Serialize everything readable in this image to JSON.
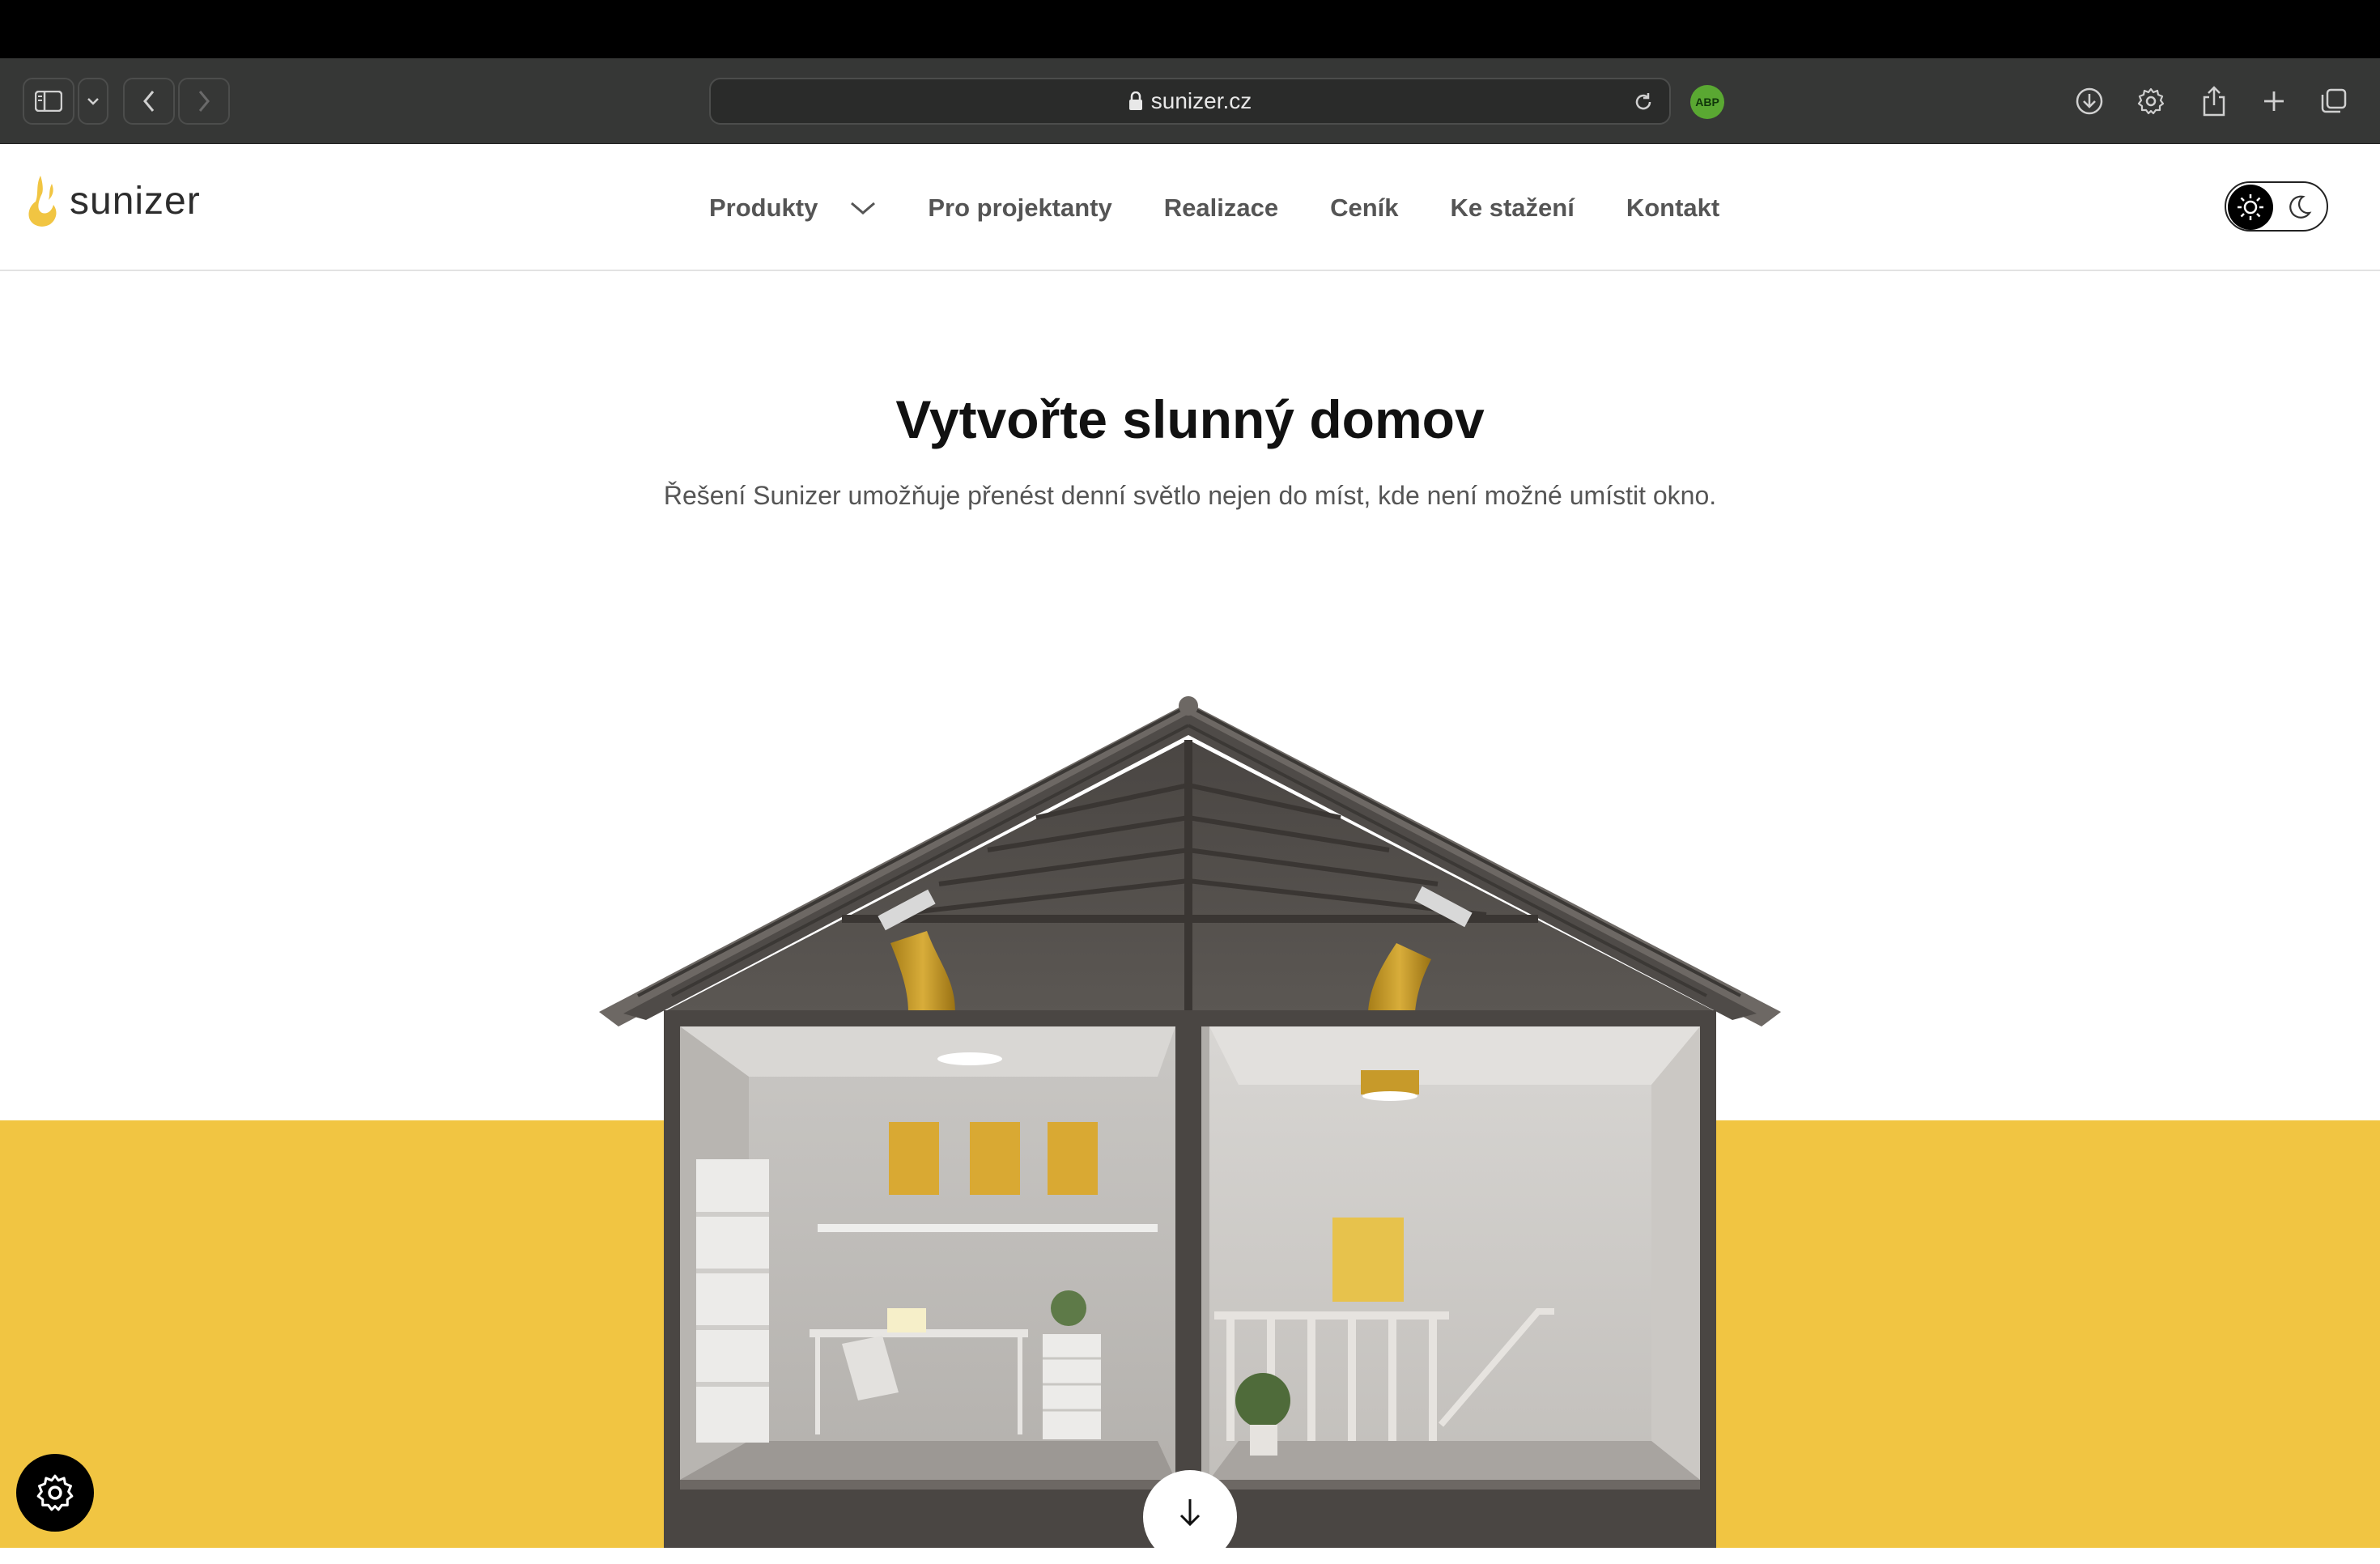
{
  "browser": {
    "url": "sunizer.cz",
    "adblock_label": "ABP",
    "icons": [
      "sidebar-icon",
      "chevron-down-icon",
      "back-icon",
      "forward-icon",
      "lock-icon",
      "reload-icon",
      "download-icon",
      "gear-icon",
      "share-icon",
      "plus-icon",
      "tabs-icon"
    ]
  },
  "site": {
    "logo_text": "sunizer",
    "nav": {
      "items": [
        {
          "label": "Produkty",
          "has_dropdown": true
        },
        {
          "label": "Pro projektanty"
        },
        {
          "label": "Realizace"
        },
        {
          "label": "Ceník"
        },
        {
          "label": "Ke stažení"
        },
        {
          "label": "Kontakt"
        }
      ]
    },
    "theme_toggle": {
      "active": "light"
    }
  },
  "hero": {
    "title": "Vytvořte slunný domov",
    "subtitle": "Řešení Sunizer umožňuje přenést denní světlo nejen do míst, kde není možné umístit okno."
  },
  "colors": {
    "accent_yellow": "#f1c542",
    "browser_chrome": "#363736",
    "text_dark": "#111111",
    "nav_text": "#555555"
  }
}
